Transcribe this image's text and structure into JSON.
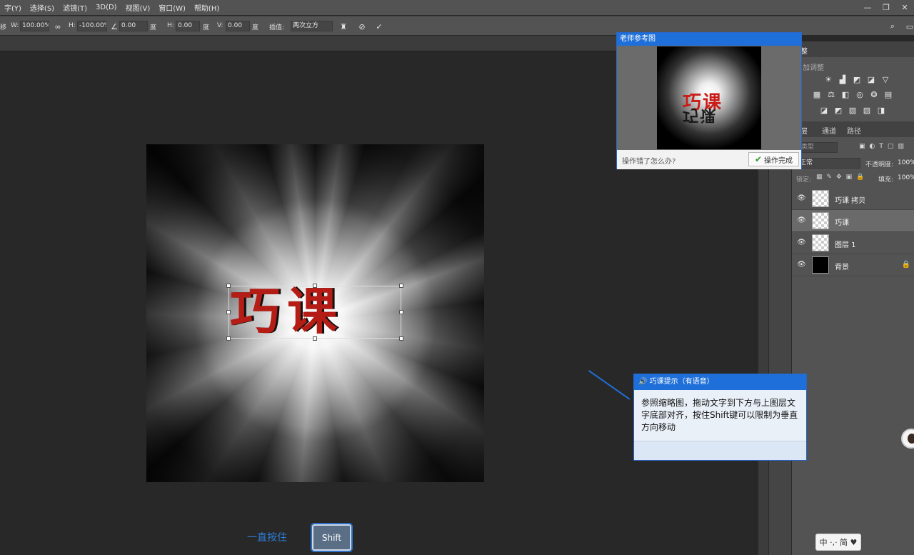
{
  "menu": [
    "字(Y)",
    "选择(S)",
    "滤镜(T)",
    "3D(D)",
    "视图(V)",
    "窗口(W)",
    "帮助(H)"
  ],
  "window_controls": [
    "—",
    "❐",
    "✕"
  ],
  "options": {
    "w_label": "W:",
    "w_value": "100.00%",
    "h_label": "H:",
    "h_value": "-100.00%",
    "angle_value": "0.00",
    "angle_unit": "度",
    "hskew_label": "H:",
    "hskew_value": "0.00",
    "hskew_unit": "度",
    "vskew_label": "V:",
    "vskew_value": "0.00",
    "vskew_unit": "度",
    "interp_label": "插值:",
    "interp_value": "两次立方"
  },
  "canvas_text": "巧课",
  "hint": {
    "label": "一直按住",
    "key": "Shift"
  },
  "reference_popup": {
    "title": "老师参考图",
    "question": "操作错了怎么办?",
    "done_label": "操作完成",
    "image_word": "巧课"
  },
  "tip_popup": {
    "title": "巧课提示（有语音）",
    "body": "参照缩略图，拖动文字到下方与上图层文字底部对齐，按住Shift键可以限制为垂直方向移动"
  },
  "adjustments_panel": {
    "tab": "整",
    "subtitle": "加调整"
  },
  "layers_panel": {
    "tabs": [
      "层",
      "通道",
      "路径"
    ],
    "filter_placeholder": "类型",
    "blend_mode": "正常",
    "opacity_label": "不透明度:",
    "opacity_value": "100%",
    "lock_label": "锁定:",
    "fill_label": "填充:",
    "fill_value": "100%",
    "layers": [
      {
        "name": "巧课 拷贝",
        "selected": false
      },
      {
        "name": "巧课",
        "selected": true
      },
      {
        "name": "图层 1",
        "selected": false
      },
      {
        "name": "背景",
        "selected": false,
        "locked": true
      }
    ]
  },
  "ime": "中 ·,· 简 ♥"
}
